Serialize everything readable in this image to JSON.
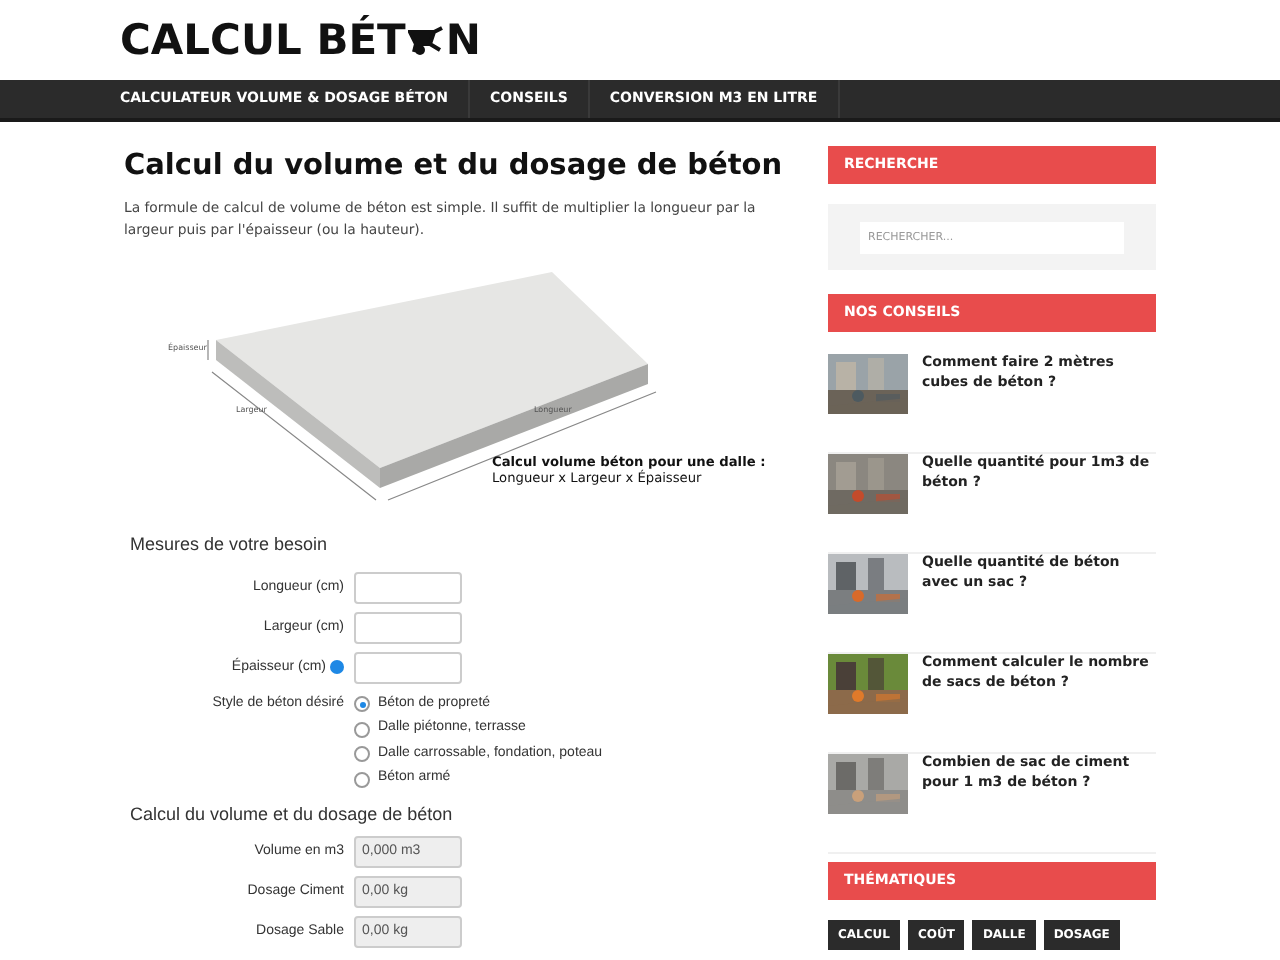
{
  "logo": {
    "before": "CALCUL BÉT",
    "after": "N"
  },
  "nav": [
    {
      "label": "CALCULATEUR VOLUME & DOSAGE BÉTON"
    },
    {
      "label": "CONSEILS"
    },
    {
      "label": "CONVERSION M3 EN LITRE"
    }
  ],
  "article": {
    "title": "Calcul du volume et du dosage de béton",
    "intro": "La formule de calcul de volume de béton est simple. Il suffit de multiplier la longueur par la largeur puis par l'épaisseur (ou la hauteur).",
    "illustration": {
      "thickness_label": "Épaisseur",
      "width_label": "Largeur",
      "length_label": "Longueur",
      "caption_title": "Calcul volume béton pour une dalle :",
      "caption_formula": "Longueur x Largeur x Épaisseur"
    }
  },
  "form": {
    "title": "Mesures de votre besoin",
    "fields": [
      {
        "label": "Longueur (cm)",
        "info": false
      },
      {
        "label": "Largeur (cm)",
        "info": false
      },
      {
        "label": "Épaisseur (cm)",
        "info": true
      }
    ],
    "style_label": "Style de béton désiré",
    "styles": [
      {
        "label": "Béton de propreté",
        "selected": true
      },
      {
        "label": "Dalle piétonne, terrasse",
        "selected": false
      },
      {
        "label": "Dalle carrossable, fondation, poteau",
        "selected": false
      },
      {
        "label": "Béton armé",
        "selected": false
      }
    ],
    "results_title": "Calcul du volume et du dosage de béton",
    "results": [
      {
        "label": "Volume en m3",
        "value": "0,000 m3"
      },
      {
        "label": "Dosage Ciment",
        "value": "0,00 kg"
      },
      {
        "label": "Dosage Sable",
        "value": "0,00 kg"
      }
    ]
  },
  "sidebar": {
    "search": {
      "title": "RECHERCHE",
      "placeholder": "RECHERCHER..."
    },
    "tips": {
      "title": "NOS CONSEILS",
      "items": [
        {
          "title": "Comment faire 2 mètres cubes de béton ?"
        },
        {
          "title": "Quelle quantité pour 1m3 de béton ?"
        },
        {
          "title": "Quelle quantité de béton avec un sac ?"
        },
        {
          "title": "Comment calculer le nombre de sacs de béton ?"
        },
        {
          "title": "Combien de sac de ciment pour 1 m3 de béton ?"
        }
      ]
    },
    "topics": {
      "title": "THÉMATIQUES",
      "tags": [
        "CALCUL",
        "COÛT",
        "DALLE",
        "DOSAGE"
      ]
    }
  }
}
